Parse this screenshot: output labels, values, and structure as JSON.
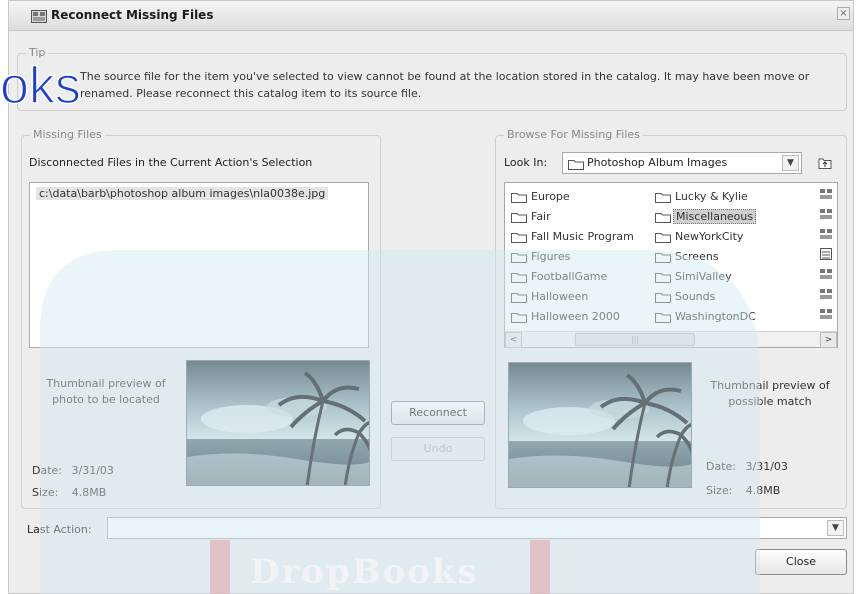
{
  "window": {
    "title": "Reconnect Missing Files",
    "close_glyph": "×"
  },
  "tip": {
    "legend": "Tip",
    "text": "The source file for the item you've selected to view cannot be found at the location stored in the catalog. It may have been move or renamed. Please reconnect this catalog item to its source file."
  },
  "missing_files": {
    "legend": "Missing Files",
    "list_label": "Disconnected Files in the Current Action's Selection",
    "files": [
      "c:\\data\\barb\\photoshop album images\\nla0038e.jpg"
    ],
    "thumb_caption": "Thumbnail preview of photo to be located",
    "date_label": "Date:",
    "date_value": "3/31/03",
    "size_label": "Size:",
    "size_value": "4.8MB"
  },
  "actions": {
    "reconnect_label": "Reconnect",
    "undo_label": "Undo"
  },
  "browse": {
    "legend": "Browse For Missing Files",
    "look_in_label": "Look In:",
    "look_in_value": "Photoshop Album Images",
    "folders_col1": [
      "Europe",
      "Fair",
      "Fall Music Program",
      "Figures",
      "FootballGame",
      "Halloween",
      "Halloween 2000"
    ],
    "folders_col2": [
      "Lucky & Kylie",
      "Miscellaneous",
      "NewYorkCity",
      "Screens",
      "SimiValley",
      "Sounds",
      "WashingtonDC"
    ],
    "selected_folder": "Miscellaneous",
    "scroll_left": "<",
    "scroll_right": ">",
    "scroll_thumb": "|||",
    "thumb_caption": "Thumbnail preview of possible match",
    "date_label": "Date:",
    "date_value": "3/31/03",
    "size_label": "Size:",
    "size_value": "4.8MB"
  },
  "footer": {
    "last_action_label": "Last Action:",
    "last_action_value": "",
    "close_label": "Close"
  },
  "overlay": {
    "logo_text": "oks",
    "watermark_text": "DropBooks"
  },
  "colors": {
    "dialog_bg": "#ededed",
    "logo_blue": "#1a3fd6",
    "watermark_cyan": "#cfe9f2",
    "watermark_red": "#e5a8a8"
  }
}
